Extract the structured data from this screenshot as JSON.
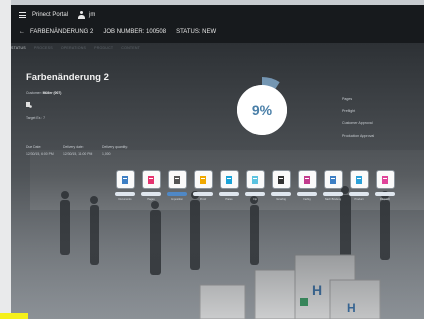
{
  "header": {
    "app_title": "Prinect Portal",
    "user_name": "jm",
    "job_name": "FARBENÄNDERUNG 2",
    "job_number": "JOB NUMBER: 100508",
    "status": "STATUS: NEW"
  },
  "tabs": [
    {
      "label": "STATUS",
      "active": true
    },
    {
      "label": "PROCESS"
    },
    {
      "label": "OPERATIONS"
    },
    {
      "label": "PRODUCT"
    },
    {
      "label": "CONTENT"
    }
  ],
  "job": {
    "title": "Farbenänderung 2",
    "customer_label": "Customer:",
    "customer_value": "Müller (007)",
    "target_label": "Target Ex.: 7",
    "due_date_label": "Due Date:",
    "due_date_value": "12/30/15, 6:00 PM",
    "delivery_date_label": "Delivery date:",
    "delivery_date_value": "12/30/15, 11:00 PM",
    "delivery_qty_label": "Delivery quantity:",
    "delivery_qty_value": "1,000"
  },
  "progress": {
    "percent_label": "9%",
    "fraction": 0.09,
    "color": "#4a7fa8"
  },
  "right_list": [
    "Pages",
    "Preflight",
    "Customer Approval",
    "Production Approval"
  ],
  "steps": [
    {
      "label": "Documents",
      "icon": "document-icon",
      "done": false
    },
    {
      "label": "Pages",
      "icon": "page-icon",
      "done": false
    },
    {
      "label": "Imposition",
      "icon": "imposition-icon",
      "done": true
    },
    {
      "label": "Proof",
      "icon": "proof-icon",
      "done": false
    },
    {
      "label": "Plates",
      "icon": "plates-icon",
      "done": false
    },
    {
      "label": "Ctp",
      "icon": "ctp-icon",
      "done": false
    },
    {
      "label": "Verarbtg",
      "icon": "verarbeitung-icon",
      "done": false
    },
    {
      "label": "Farbig",
      "icon": "color-icon",
      "done": false
    },
    {
      "label": "Nach Bindung",
      "icon": "binding-icon",
      "done": false
    },
    {
      "label": "Product",
      "icon": "product-icon",
      "done": false
    },
    {
      "label": "Dispatch",
      "icon": "dispatch-icon",
      "done": false
    }
  ]
}
